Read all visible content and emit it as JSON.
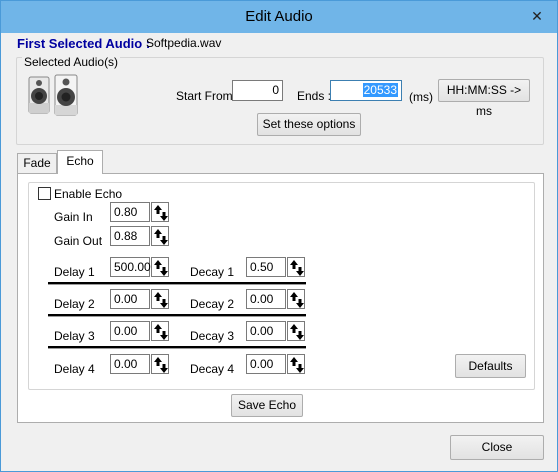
{
  "window": {
    "title": "Edit Audio",
    "close_glyph": "✕"
  },
  "header": {
    "first_selected_label": "First Selected Audio :",
    "filename": "Softpedia.wav"
  },
  "selected_audio": {
    "group_label": "Selected Audio(s)",
    "speaker_icon": "speaker-icon",
    "start_from_label": "Start From :",
    "start_from_value": "0",
    "ends_label": "Ends :",
    "ends_value": "20533",
    "ms_label": "(ms)",
    "hms_button": "HH:MM:SS -> ms",
    "set_options_button": "Set these options"
  },
  "tabs": [
    {
      "label": "Fade"
    },
    {
      "label": "Echo"
    }
  ],
  "echo": {
    "enable_label": "Enable Echo",
    "enabled": false,
    "gain_in_label": "Gain In",
    "gain_in_value": "0.80",
    "gain_out_label": "Gain Out",
    "gain_out_value": "0.88",
    "rows": [
      {
        "delay_label": "Delay 1",
        "delay_value": "500.00",
        "decay_label": "Decay 1",
        "decay_value": "0.50"
      },
      {
        "delay_label": "Delay 2",
        "delay_value": "0.00",
        "decay_label": "Decay 2",
        "decay_value": "0.00"
      },
      {
        "delay_label": "Delay 3",
        "delay_value": "0.00",
        "decay_label": "Decay 3",
        "decay_value": "0.00"
      },
      {
        "delay_label": "Delay 4",
        "delay_value": "0.00",
        "decay_label": "Decay 4",
        "decay_value": "0.00"
      }
    ],
    "defaults_button": "Defaults",
    "save_button": "Save Echo"
  },
  "footer": {
    "close_button": "Close"
  },
  "colors": {
    "titlebar": "#70b5e8",
    "header_text": "#0000a0",
    "selection": "#3399ff"
  }
}
